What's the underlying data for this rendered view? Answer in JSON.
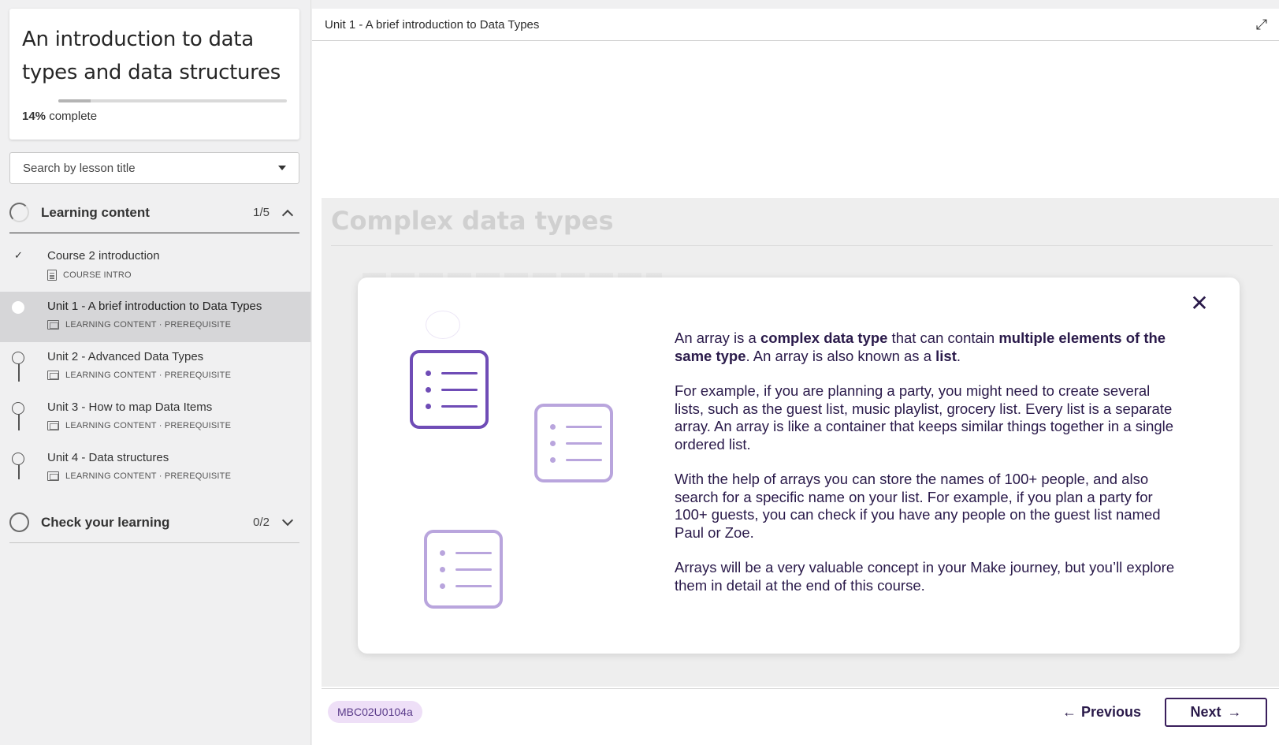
{
  "course": {
    "title": "An introduction to data types and data structures",
    "progress_percent": 14,
    "progress_value": "14%",
    "progress_suffix": "complete"
  },
  "search": {
    "placeholder": "Search by lesson title"
  },
  "sections": [
    {
      "label": "Learning content",
      "count": "1/5",
      "expanded": true,
      "lessons": [
        {
          "title": "Course 2 introduction",
          "meta": "COURSE INTRO",
          "status": "completed",
          "icon": "document-icon"
        },
        {
          "title": "Unit 1 - A brief introduction to Data Types",
          "meta": "LEARNING CONTENT · PREREQUISITE",
          "status": "current",
          "icon": "slides-icon"
        },
        {
          "title": "Unit 2 - Advanced Data Types",
          "meta": "LEARNING CONTENT · PREREQUISITE",
          "status": "not-started",
          "icon": "slides-icon"
        },
        {
          "title": "Unit 3 - How to map Data Items",
          "meta": "LEARNING CONTENT · PREREQUISITE",
          "status": "not-started",
          "icon": "slides-icon"
        },
        {
          "title": "Unit 4 - Data structures",
          "meta": "LEARNING CONTENT · PREREQUISITE",
          "status": "not-started",
          "icon": "slides-icon"
        }
      ]
    },
    {
      "label": "Check your learning",
      "count": "0/2",
      "expanded": false
    }
  ],
  "main": {
    "title": "Unit 1 - A brief introduction to Data Types",
    "heading": "Complex data types",
    "modal": {
      "p1": {
        "a": "An array is a ",
        "b1": "complex data type",
        "c": " that can contain ",
        "b2": "multiple elements of the same type",
        "d": ". An array is also known as a ",
        "b3": "list",
        "e": "."
      },
      "p2": "For example, if you are planning a party, you might need to create several lists, such as the guest list, music playlist, grocery list. Every list is a separate array. An array is like a container that keeps similar things together in a single ordered list.",
      "p3": "With the help of arrays you can store the names of 100+ people, and also search for a specific name on your list. For example, if you plan a party for 100+ guests, you can check if you have any people on the guest list named Paul or Zoe.",
      "p4": "Arrays will be a very valuable concept in your Make journey, but you’ll explore them in detail at the end of this course.",
      "close_label": "✕"
    },
    "code": "MBC02U0104a",
    "previous_label": "Previous",
    "next_label": "Next"
  },
  "colors": {
    "accent": "#3a1f5c",
    "illustration_strong": "#6f4cb6",
    "illustration_light": "#b9a5dd",
    "badge_bg": "#eedff7"
  }
}
